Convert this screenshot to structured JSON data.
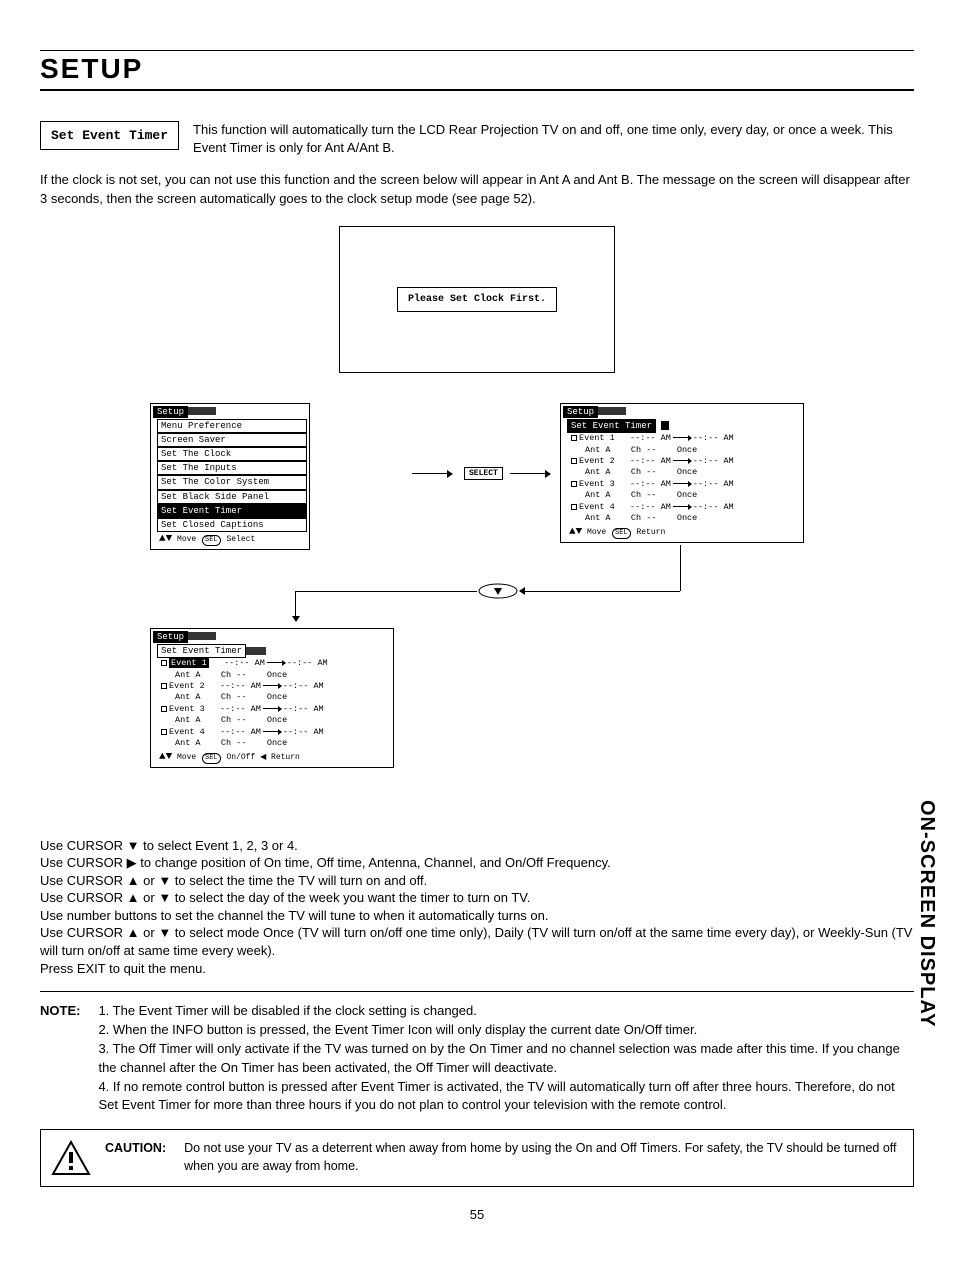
{
  "page": {
    "title": "SETUP",
    "sideLabel": "ON-SCREEN DISPLAY",
    "pageNumber": "55"
  },
  "header": {
    "boxLabel": "Set Event Timer",
    "intro": "This function will automatically turn the LCD Rear Projection TV on and off, one time only, every day, or once a week.  This Event Timer is only for Ant A/Ant B."
  },
  "clockPara": "If the clock is not set, you can not use this function and the screen below will appear in Ant A and Ant B.  The message on the screen will disappear after 3 seconds, then the screen automatically goes to the clock setup mode (see page 52).",
  "clockMsg": "Please Set Clock First.",
  "setupMenu": {
    "title": "Setup",
    "items": [
      "Menu Preference",
      "Screen Saver",
      "Set The Clock",
      "Set The Inputs",
      "Set The Color System",
      "Set Black Side Panel",
      "Set Event Timer",
      "Set Closed Captions"
    ],
    "selected": "Set Event Timer",
    "hint": "Move",
    "hint2": "Select"
  },
  "selectBtn": "SELECT",
  "timerMenu": {
    "title": "Setup",
    "subtitle": "Set Event Timer",
    "events": [
      {
        "name": "Event 1",
        "on": "--:-- AM",
        "off": "--:-- AM",
        "ant": "Ant A",
        "ch": "Ch --",
        "freq": "Once"
      },
      {
        "name": "Event 2",
        "on": "--:-- AM",
        "off": "--:-- AM",
        "ant": "Ant A",
        "ch": "Ch --",
        "freq": "Once"
      },
      {
        "name": "Event 3",
        "on": "--:-- AM",
        "off": "--:-- AM",
        "ant": "Ant A",
        "ch": "Ch --",
        "freq": "Once"
      },
      {
        "name": "Event 4",
        "on": "--:-- AM",
        "off": "--:-- AM",
        "ant": "Ant A",
        "ch": "Ch --",
        "freq": "Once"
      }
    ],
    "hintA": "Move",
    "hintARet": "Return",
    "hintB": "Move",
    "hintBOn": "On/Off",
    "hintBRet": "Return"
  },
  "instructions": [
    "Use CURSOR ▼ to select Event 1, 2, 3 or 4.",
    "Use CURSOR ▶ to change position of On time, Off time, Antenna, Channel, and On/Off Frequency.",
    "Use CURSOR ▲ or ▼ to select the time the TV will turn on and off.",
    "Use CURSOR ▲ or ▼ to select the day of the week you want the timer to turn on TV.",
    "Use number buttons to set the channel the TV will tune to when it automatically turns on.",
    "Use CURSOR ▲ or ▼ to select mode Once (TV will turn on/off one time only), Daily (TV will turn on/off at the same time every day), or Weekly-Sun (TV will turn on/off at same time every week).",
    "Press EXIT to quit the menu."
  ],
  "note": {
    "label": "NOTE:",
    "items": [
      "1. The Event Timer will be disabled if the clock setting is changed.",
      "2. When the INFO button is pressed, the Event Timer Icon will only display the current date On/Off timer.",
      "3. The Off Timer will only activate if the TV was turned on by the On Timer and no channel selection was made after this time.  If you change the channel after the On Timer has been activated, the Off Timer will deactivate.",
      "4. If no remote control button is pressed after Event Timer is activated, the TV will automatically turn off after three hours.  Therefore, do not Set Event Timer for more than three hours if you do not plan to control your television with the remote control."
    ]
  },
  "caution": {
    "label": "CAUTION:",
    "text": "Do not use your TV as a deterrent when away from home by using the On and Off Timers.  For safety, the TV should be turned off when you are away from home."
  }
}
